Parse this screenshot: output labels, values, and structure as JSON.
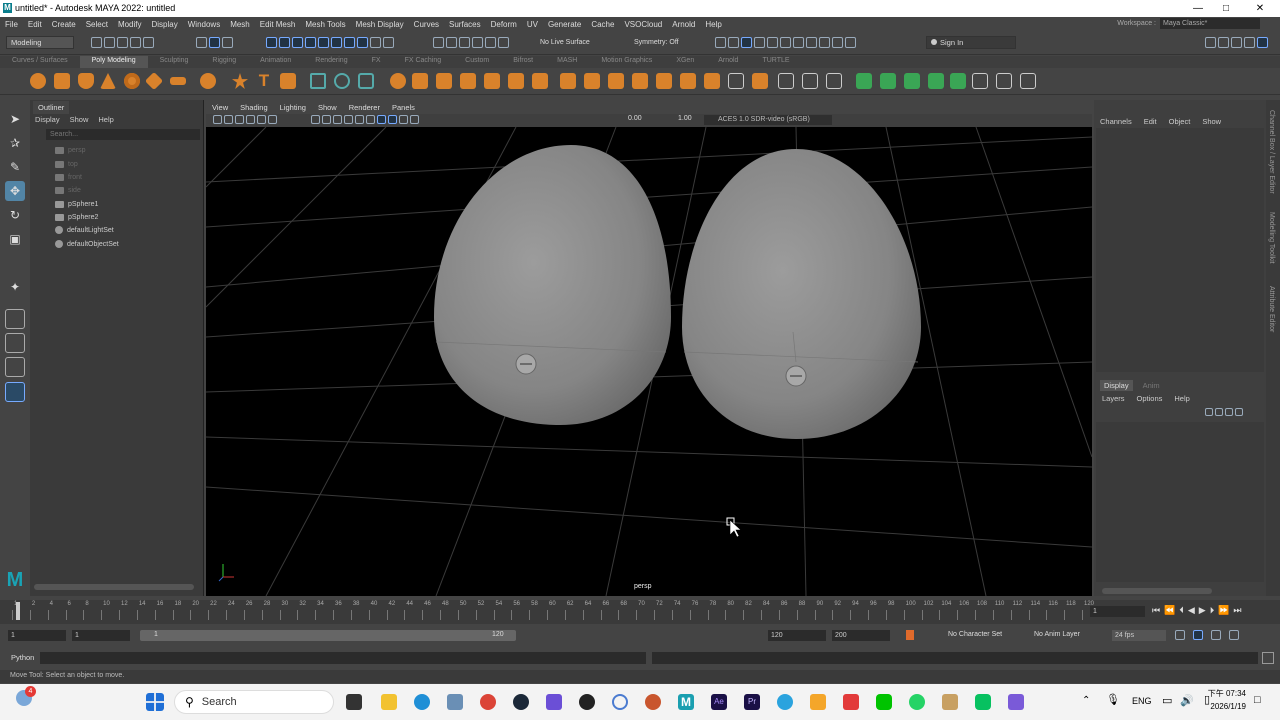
{
  "window": {
    "title": "untitled* - Autodesk MAYA 2022: untitled",
    "minimize": "—",
    "maximize": "□",
    "close": "✕"
  },
  "menubar": {
    "items": [
      "File",
      "Edit",
      "Create",
      "Select",
      "Modify",
      "Display",
      "Windows",
      "Mesh",
      "Edit Mesh",
      "Mesh Tools",
      "Mesh Display",
      "Curves",
      "Surfaces",
      "Deform",
      "UV",
      "Generate",
      "Cache",
      "VSOCloud",
      "Arnold",
      "Help"
    ],
    "workspace_label": "Workspace :",
    "workspace_value": "Maya Classic*"
  },
  "statusline": {
    "menuset": "Modeling",
    "live_surface": "No Live Surface",
    "symmetry": "Symmetry: Off",
    "sign_in": "Sign In"
  },
  "shelf": {
    "tabs": [
      "Curves / Surfaces",
      "Poly Modeling",
      "Sculpting",
      "Rigging",
      "Animation",
      "Rendering",
      "FX",
      "FX Caching",
      "Custom",
      "Bifrost",
      "MASH",
      "Motion Graphics",
      "XGen",
      "Arnold",
      "TURTLE"
    ],
    "active": "Poly Modeling"
  },
  "outliner": {
    "tab": "Outliner",
    "menu": [
      "Display",
      "Show",
      "Help"
    ],
    "search_placeholder": "Search...",
    "items": [
      "persp",
      "top",
      "front",
      "side",
      "pSphere1",
      "pSphere2",
      "defaultLightSet",
      "defaultObjectSet"
    ]
  },
  "viewport": {
    "menu": [
      "View",
      "Shading",
      "Lighting",
      "Show",
      "Renderer",
      "Panels"
    ],
    "exposure": "0.00",
    "gamma": "1.00",
    "colorspace": "ACES 1.0 SDR-video (sRGB)",
    "camera_label": "persp"
  },
  "channelbox": {
    "menu": [
      "Channels",
      "Edit",
      "Object",
      "Show"
    ]
  },
  "layers": {
    "tabs": [
      "Display",
      "Anim"
    ],
    "menu": [
      "Layers",
      "Options",
      "Help"
    ]
  },
  "sidetabs": [
    "Channel Box / Layer Editor",
    "Modelling Toolkit",
    "Attribute Editor"
  ],
  "timeslider": {
    "ticks": [
      "1",
      "2",
      "4",
      "6",
      "8",
      "10",
      "12",
      "14",
      "16",
      "18",
      "20",
      "22",
      "24",
      "26",
      "28",
      "30",
      "32",
      "34",
      "36",
      "38",
      "40",
      "42",
      "44",
      "46",
      "48",
      "50",
      "52",
      "54",
      "56",
      "58",
      "60",
      "62",
      "64",
      "66",
      "68",
      "70",
      "72",
      "74",
      "76",
      "78",
      "80",
      "82",
      "84",
      "86",
      "88",
      "90",
      "92",
      "94",
      "96",
      "98",
      "100",
      "102",
      "104",
      "106",
      "108",
      "110",
      "112",
      "114",
      "116",
      "118",
      "120"
    ],
    "current_frame": "1"
  },
  "rangeslider": {
    "start": "1",
    "anim_start": "1",
    "range_start": "1",
    "range_end": "120",
    "end": "120",
    "anim_end": "200",
    "char_set": "No Character Set",
    "anim_layer": "No Anim Layer",
    "fps": "24 fps"
  },
  "cmdline": {
    "lang": "Python"
  },
  "helpline": {
    "text": "Move Tool: Select an object to move."
  },
  "taskbar": {
    "search": "Search",
    "lang": "ENG",
    "time": "下午 07:34",
    "date": "2026/1/19",
    "badge": "4"
  }
}
